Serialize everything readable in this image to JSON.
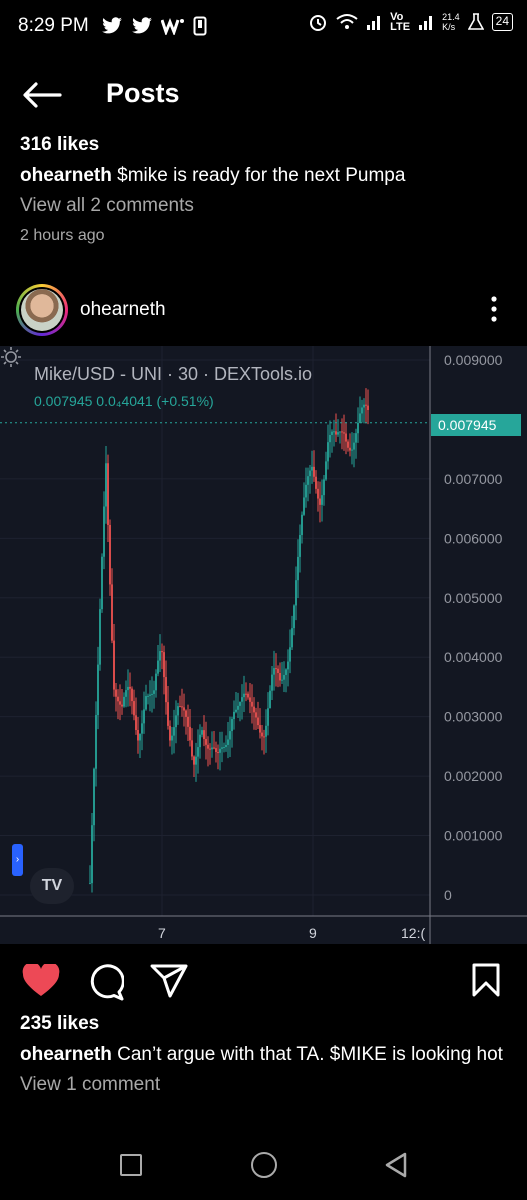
{
  "status_bar": {
    "time": "8:29 PM",
    "left_icons": [
      "twitter-icon",
      "twitter-icon",
      "w-icon",
      "phone-icon"
    ],
    "right_icons": [
      "alarm-icon",
      "wifi-icon",
      "signal-icon",
      "volte-icon",
      "signal-icon",
      "flask-icon"
    ],
    "network_speed": "21.4\nK/s",
    "vo_lte": "Vo\nLTE",
    "battery": "24"
  },
  "header": {
    "title": "Posts"
  },
  "previous_post": {
    "likes": "316 likes",
    "username": "ohearneth",
    "caption": " $mike is ready for the next Pumpa",
    "view_comments": "View all 2 comments",
    "time_ago": "2 hours ago"
  },
  "post": {
    "username": "ohearneth",
    "likes": "235 likes",
    "caption": " Can’t argue with that TA. $MIKE is looking hot",
    "view_comments": "View 1 comment",
    "liked": true,
    "like_color": "#ed4956"
  },
  "chart_data": {
    "type": "candlestick",
    "title": "Mike/USD - UNI · 30 · DEXTools.io",
    "ohlc_readout": "0.007945  0.0₄4041 (+0.51%)",
    "current_price_label": "0.007945",
    "y_ticks": [
      "0.009000",
      "0.007000",
      "0.006000",
      "0.005000",
      "0.004000",
      "0.003000",
      "0.002000",
      "0.001000",
      "0"
    ],
    "x_ticks": [
      "7",
      "9",
      "12:("
    ],
    "ylim": [
      0,
      0.009
    ],
    "current_price": 0.007945,
    "up_color": "#26a69a",
    "down_color": "#ef5350",
    "price_path": [
      0.0002,
      0.0035,
      0.0074,
      0.0038,
      0.003,
      0.0032,
      0.0028,
      0.0036,
      0.0031,
      0.004,
      0.0029,
      0.0033,
      0.0027,
      0.0021,
      0.0032,
      0.0024,
      0.002,
      0.0026,
      0.0034,
      0.0031,
      0.003,
      0.0032,
      0.0029,
      0.0035,
      0.0034,
      0.0043,
      0.0055,
      0.0064,
      0.0072,
      0.0069,
      0.0076,
      0.0074,
      0.0079,
      0.0078,
      0.0079,
      0.0079
    ]
  },
  "nav_bar": {
    "icons": [
      "recent-apps-icon",
      "home-icon",
      "back-icon"
    ]
  }
}
